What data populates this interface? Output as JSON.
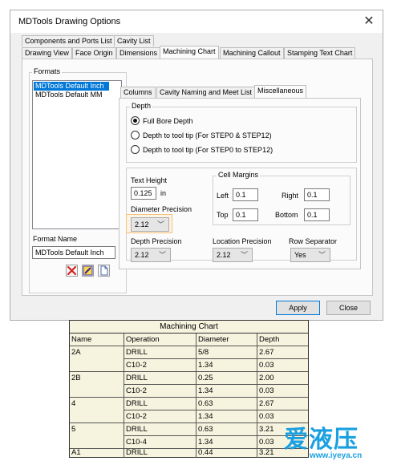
{
  "dialog": {
    "title": "MDTools Drawing Options",
    "close_glyph": "✕",
    "tabs_row1": [
      "Components and Ports List",
      "Cavity List"
    ],
    "tabs_row2": [
      "Drawing View",
      "Face Origin",
      "Dimensions",
      "Machining Chart",
      "Machining Callout",
      "Stamping Text Chart"
    ],
    "active_tab": "Machining Chart",
    "formats": {
      "label": "Formats",
      "items": [
        "MDTools Default Inch",
        "MDTools Default MM"
      ],
      "selected": "MDTools Default Inch",
      "format_name_label": "Format Name",
      "format_name_value": "MDTools Default Inch",
      "icons": [
        "delete-icon",
        "edit-icon",
        "new-document-icon"
      ]
    },
    "subtabs": [
      "Columns",
      "Cavity Naming and Meet List",
      "Miscellaneous"
    ],
    "active_subtab": "Miscellaneous",
    "depth": {
      "label": "Depth",
      "options": [
        "Full Bore Depth",
        "Depth to tool tip (For STEP0 & STEP12)",
        "Depth to tool tip (For STEP0 to STEP12)"
      ],
      "selected_index": 0
    },
    "text_height": {
      "label": "Text Height",
      "value": "0.125",
      "unit": "in"
    },
    "diameter_precision": {
      "label": "Diameter Precision",
      "value": "2.12"
    },
    "cell_margins": {
      "label": "Cell Margins",
      "left_label": "Left",
      "left_value": "0.1",
      "right_label": "Right",
      "right_value": "0.1",
      "top_label": "Top",
      "top_value": "0.1",
      "bottom_label": "Bottom",
      "bottom_value": "0.1"
    },
    "depth_precision": {
      "label": "Depth Precision",
      "value": "2.12"
    },
    "location_precision": {
      "label": "Location Precision",
      "value": "2.12"
    },
    "row_separator": {
      "label": "Row Separator",
      "value": "Yes"
    },
    "buttons": {
      "apply": "Apply",
      "close": "Close"
    },
    "highlight_color": "#f5c27a",
    "accent_color": "#0078d7"
  },
  "machining_chart": {
    "title": "Machining Chart",
    "columns": [
      "Name",
      "Operation",
      "Diameter",
      "Depth"
    ],
    "rows": [
      [
        "2A",
        "DRILL",
        "5/8",
        "2.67"
      ],
      [
        "",
        "C10-2",
        "1.34",
        "0.03"
      ],
      [
        "2B",
        "DRILL",
        "0.25",
        "2.00"
      ],
      [
        "",
        "C10-2",
        "1.34",
        "0.03"
      ],
      [
        "4",
        "DRILL",
        "0.63",
        "2.67"
      ],
      [
        "",
        "C10-2",
        "1.34",
        "0.03"
      ],
      [
        "5",
        "DRILL",
        "0.63",
        "3.21"
      ],
      [
        "",
        "C10-4",
        "1.34",
        "0.03"
      ],
      [
        "A1",
        "DRILL",
        "0.44",
        "3.21"
      ]
    ],
    "background": "#f6f4df"
  },
  "watermark": {
    "text": "爱液压",
    "url": "www.iyeya.cn"
  }
}
